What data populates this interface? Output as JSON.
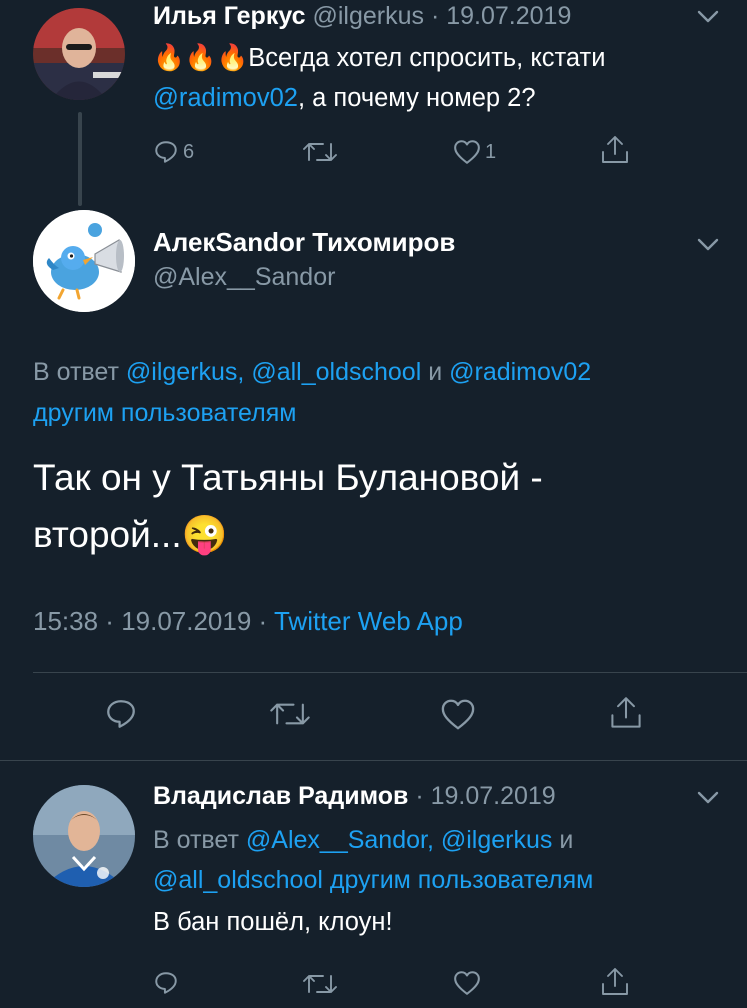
{
  "tweet1": {
    "name": "Илья Геркус",
    "handle": "@ilgerkus",
    "sep": " · ",
    "date": "19.07.2019",
    "emoji": "🔥🔥🔥",
    "text_part1": "Всегда хотел спросить, кстати",
    "mention": "@radimov02",
    "text_part2": ", а почему номер 2?",
    "replies": "6",
    "likes": "1"
  },
  "tweet2": {
    "name": "АлекSandor Тихомиров",
    "handle": "@Alex__Sandor",
    "reply_prefix": "В ответ ",
    "reply_mentions": "@ilgerkus, @all_oldschool",
    "reply_and": " и ",
    "reply_mention_last": "@radimov02",
    "reply_suffix": "другим пользователям",
    "text_line1": "Так он у Татьяны Булановой -",
    "text_line2": "второй...",
    "emoji": "😜",
    "time": "15:38",
    "sep1": " · ",
    "date": "19.07.2019",
    "sep2": " · ",
    "source": "Twitter Web App"
  },
  "tweet3": {
    "name": "Владислав Радимов",
    "sep": " · ",
    "date": "19.07.2019",
    "reply_prefix": "В ответ ",
    "reply_mentions": "@Alex__Sandor, @ilgerkus",
    "reply_and": " и",
    "reply_mention_last": "@all_oldschool",
    "reply_suffix": " другим пользователям",
    "text": "В бан пошёл, клоун!"
  },
  "colors": {
    "background": "#15202b",
    "accent": "#1da1f2",
    "muted": "#8899a6",
    "divider": "#38444d"
  }
}
